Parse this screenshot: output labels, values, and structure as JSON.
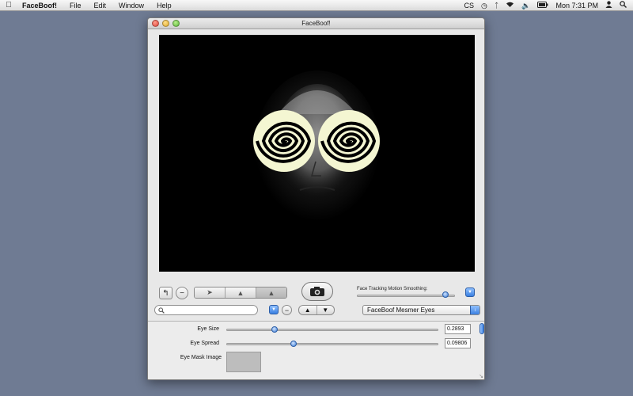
{
  "menubar": {
    "apple_icon": "apple-icon",
    "app_name": "FaceBoof!",
    "menus": [
      "File",
      "Edit",
      "Window",
      "Help"
    ],
    "status": {
      "cs": "CS",
      "clock": "Mon 7:31 PM"
    }
  },
  "window": {
    "title": "FaceBoof!"
  },
  "toolbar": {
    "smoothing_label": "Face Tracking Motion Smoothing:",
    "smoothing_value": 0.93,
    "search_placeholder": "",
    "effect_selected": "FaceBoof Mesmer Eyes"
  },
  "parameters": [
    {
      "label": "Eye Size",
      "value": "0.2893",
      "slider": 0.22
    },
    {
      "label": "Eye Spread",
      "value": "0.09806",
      "slider": 0.31
    }
  ],
  "eye_mask": {
    "label": "Eye Mask Image"
  },
  "colors": {
    "desktop": "#6f7b93",
    "accent": "#3a7fe0",
    "spiral_fill": "#f4f6d2"
  }
}
